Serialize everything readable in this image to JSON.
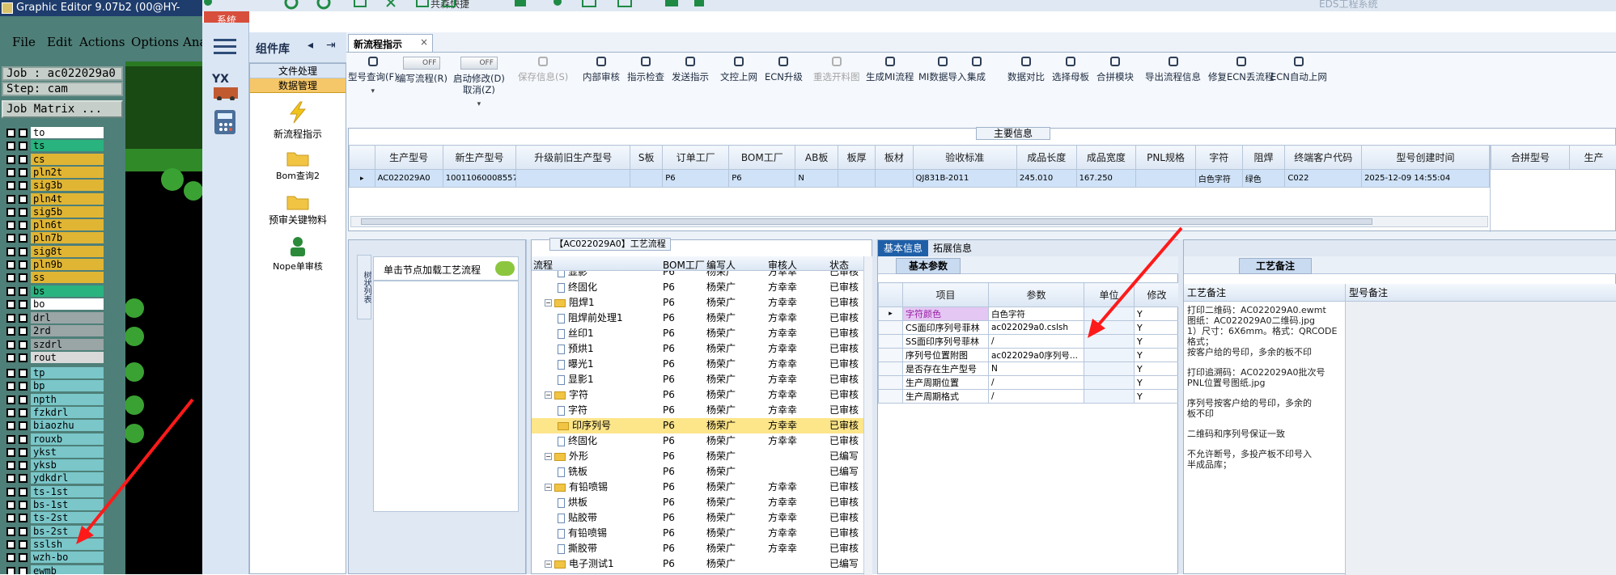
{
  "graphic_editor": {
    "title": "Graphic Editor 9.07b2 (00@HY-",
    "menu": [
      "File",
      "Edit",
      "Actions",
      "Options",
      "Ana"
    ],
    "job_label": "Job : ac022029a0",
    "step_label": "Step: cam",
    "matrix_button": "Job Matrix ...",
    "layers_group1": [
      {
        "name": "to",
        "color": "#ffffff"
      },
      {
        "name": "ts",
        "color": "#29b37f"
      },
      {
        "name": "cs",
        "color": "#e0b534"
      },
      {
        "name": "pln2t",
        "color": "#e0b534"
      },
      {
        "name": "sig3b",
        "color": "#e0b534"
      },
      {
        "name": "pln4t",
        "color": "#e0b534"
      },
      {
        "name": "sig5b",
        "color": "#e0b534"
      },
      {
        "name": "pln6t",
        "color": "#e0b534"
      },
      {
        "name": "pln7b",
        "color": "#e0b534"
      },
      {
        "name": "sig8t",
        "color": "#e0b534"
      },
      {
        "name": "pln9b",
        "color": "#e0b534"
      },
      {
        "name": "ss",
        "color": "#e0b534"
      },
      {
        "name": "bs",
        "color": "#29b37f"
      },
      {
        "name": "bo",
        "color": "#ffffff"
      }
    ],
    "layers_group2": [
      {
        "name": "drl",
        "color": "#9aa5a6"
      },
      {
        "name": "2rd",
        "color": "#9aa5a6"
      },
      {
        "name": "szdrl",
        "color": "#9aa5a6"
      },
      {
        "name": "rout",
        "color": "#d9d9d9"
      }
    ],
    "layers_group3": [
      {
        "name": "tp",
        "color": "#7ac6c9"
      },
      {
        "name": "bp",
        "color": "#7ac6c9"
      },
      {
        "name": "npth",
        "color": "#7ac6c9"
      },
      {
        "name": "fzkdrl",
        "color": "#7ac6c9"
      },
      {
        "name": "biaozhu",
        "color": "#7ac6c9"
      },
      {
        "name": "rouxb",
        "color": "#7ac6c9"
      },
      {
        "name": "ykst",
        "color": "#7ac6c9"
      },
      {
        "name": "yksb",
        "color": "#7ac6c9"
      },
      {
        "name": "ydkdrl",
        "color": "#7ac6c9"
      },
      {
        "name": "ts-1st",
        "color": "#7ac6c9"
      },
      {
        "name": "bs-1st",
        "color": "#7ac6c9"
      },
      {
        "name": "ts-2st",
        "color": "#7ac6c9"
      },
      {
        "name": "bs-2st",
        "color": "#7ac6c9"
      },
      {
        "name": "sslsh",
        "color": "#7ac6c9"
      },
      {
        "name": "wzh-bo",
        "color": "#7ac6c9"
      },
      {
        "name": "ewmb",
        "color": "#7ac6c9"
      }
    ]
  },
  "app": {
    "top_partial": "共森快捷",
    "window_title": "EDS工程系统",
    "system_tab": "系统",
    "component_lib": "组件库",
    "yx_label": "YX",
    "lib_sections": [
      "文件处理",
      "数据管理"
    ],
    "lib_items": [
      "新流程指示",
      "Bom查询2",
      "预审关键物料",
      "Nope单审核"
    ],
    "doc_tab": "新流程指示",
    "toolbar": [
      {
        "label": "型号查询(F)",
        "sub": "",
        "dis": false,
        "icon": "search-icon"
      },
      {
        "label": "编写流程(R)",
        "sub": "OFF",
        "dis": false,
        "icon": "toggle-icon"
      },
      {
        "label": "启动修改(D)",
        "sub": "OFF",
        "label2": "取消(Z)",
        "dis": false,
        "icon": "toggle-icon"
      },
      {
        "label": "保存信息(S)",
        "dis": true,
        "icon": "check-icon"
      },
      {
        "label": "内部审核",
        "dis": false,
        "icon": "print-icon"
      },
      {
        "label": "指示检查",
        "dis": false,
        "icon": "checklist-icon"
      },
      {
        "label": "发送指示",
        "dis": false,
        "icon": "upload-icon"
      },
      {
        "label": "文控上网",
        "dis": false,
        "icon": "cloud-upload-icon"
      },
      {
        "label": "ECN升级",
        "dis": false,
        "icon": "text-icon"
      },
      {
        "label": "重选开料图",
        "dis": true,
        "icon": "image-icon"
      },
      {
        "label": "生成MI流程",
        "dis": false,
        "icon": "gears-icon"
      },
      {
        "label": "MI数据导入",
        "dis": false,
        "icon": "import-icon"
      },
      {
        "label": "集成",
        "dis": false,
        "icon": "download-icon"
      },
      {
        "label": "数据对比",
        "dis": false,
        "icon": "compare-icon"
      },
      {
        "label": "选择母板",
        "dis": false,
        "icon": "shuffle-icon"
      },
      {
        "label": "合拼模块",
        "dis": false,
        "icon": "merge-icon"
      },
      {
        "label": "导出流程信息",
        "dis": false,
        "icon": "smile-icon"
      },
      {
        "label": "修复ECN丢流程",
        "dis": false,
        "icon": "wrench-icon"
      },
      {
        "label": "ECN自动上网",
        "dis": false,
        "icon": "star-icon"
      }
    ],
    "main_info_title": "主要信息",
    "main_headers": [
      "生产型号",
      "新生产型号",
      "升级前旧生产型号",
      "S板",
      "订单工厂",
      "BOM工厂",
      "AB板",
      "板厚",
      "板材",
      "验收标准",
      "成品长度",
      "成品宽度",
      "PNL规格",
      "字符",
      "阻焊",
      "终端客户代码",
      "型号创建时间"
    ],
    "main_row": [
      "AC022029A0",
      "10011060008557",
      "",
      "",
      "P6",
      "P6",
      "N",
      "",
      "",
      "QJ831B-2011",
      "245.010",
      "167.250",
      "",
      "白色字符",
      "绿色",
      "C022",
      "2025-12-09 14:55:04"
    ],
    "right_headers": [
      "合拼型号",
      "生产"
    ],
    "left_panel_title": "单击节点加载工艺流程",
    "left_panel_side": "树状列表",
    "process_title": "【AC022029A0】工艺流程",
    "process_headers": [
      "流程",
      "BOM工厂",
      "编写人",
      "审核人",
      "状态"
    ],
    "process_rows": [
      {
        "name": "显影",
        "level": 2,
        "type": "doc",
        "bom": "P6",
        "writer": "杨荣广",
        "checker": "方幸幸",
        "status": "已审核"
      },
      {
        "name": "终固化",
        "level": 2,
        "type": "doc",
        "bom": "P6",
        "writer": "杨荣广",
        "checker": "方幸幸",
        "status": "已审核"
      },
      {
        "name": "阻焊1",
        "level": 1,
        "type": "folder",
        "bom": "P6",
        "writer": "杨荣广",
        "checker": "方幸幸",
        "status": "已审核"
      },
      {
        "name": "阻焊前处理1",
        "level": 2,
        "type": "doc",
        "bom": "P6",
        "writer": "杨荣广",
        "checker": "方幸幸",
        "status": "已审核"
      },
      {
        "name": "丝印1",
        "level": 2,
        "type": "doc",
        "bom": "P6",
        "writer": "杨荣广",
        "checker": "方幸幸",
        "status": "已审核"
      },
      {
        "name": "预烘1",
        "level": 2,
        "type": "doc",
        "bom": "P6",
        "writer": "杨荣广",
        "checker": "方幸幸",
        "status": "已审核"
      },
      {
        "name": "曝光1",
        "level": 2,
        "type": "doc",
        "bom": "P6",
        "writer": "杨荣广",
        "checker": "方幸幸",
        "status": "已审核"
      },
      {
        "name": "显影1",
        "level": 2,
        "type": "doc",
        "bom": "P6",
        "writer": "杨荣广",
        "checker": "方幸幸",
        "status": "已审核"
      },
      {
        "name": "字符",
        "level": 1,
        "type": "folder",
        "bom": "P6",
        "writer": "杨荣广",
        "checker": "方幸幸",
        "status": "已审核"
      },
      {
        "name": "字符",
        "level": 2,
        "type": "doc",
        "bom": "P6",
        "writer": "杨荣广",
        "checker": "方幸幸",
        "status": "已审核"
      },
      {
        "name": "印序列号",
        "level": 2,
        "type": "folder",
        "bom": "P6",
        "writer": "杨荣广",
        "checker": "方幸幸",
        "status": "已审核",
        "selected": true
      },
      {
        "name": "终固化",
        "level": 2,
        "type": "doc",
        "bom": "P6",
        "writer": "杨荣广",
        "checker": "方幸幸",
        "status": "已审核"
      },
      {
        "name": "外形",
        "level": 1,
        "type": "folder",
        "bom": "P6",
        "writer": "杨荣广",
        "checker": "",
        "status": "已编写"
      },
      {
        "name": "铣板",
        "level": 2,
        "type": "doc",
        "bom": "P6",
        "writer": "杨荣广",
        "checker": "",
        "status": "已编写"
      },
      {
        "name": "有铅喷锡",
        "level": 1,
        "type": "folder",
        "bom": "P6",
        "writer": "杨荣广",
        "checker": "方幸幸",
        "status": "已审核"
      },
      {
        "name": "烘板",
        "level": 2,
        "type": "doc",
        "bom": "P6",
        "writer": "杨荣广",
        "checker": "方幸幸",
        "status": "已审核"
      },
      {
        "name": "贴胶带",
        "level": 2,
        "type": "doc",
        "bom": "P6",
        "writer": "杨荣广",
        "checker": "方幸幸",
        "status": "已审核"
      },
      {
        "name": "有铅喷锡",
        "level": 2,
        "type": "doc",
        "bom": "P6",
        "writer": "杨荣广",
        "checker": "方幸幸",
        "status": "已审核"
      },
      {
        "name": "撕胶带",
        "level": 2,
        "type": "doc",
        "bom": "P6",
        "writer": "杨荣广",
        "checker": "方幸幸",
        "status": "已审核"
      },
      {
        "name": "电子测试1",
        "level": 1,
        "type": "folder",
        "bom": "P6",
        "writer": "杨荣广",
        "checker": "",
        "status": "已编写"
      }
    ],
    "info_tabs": [
      "基本信息",
      "拓展信息"
    ],
    "basic_params_tab": "基本参数",
    "param_headers": [
      "项目",
      "参数",
      "单位",
      "修改"
    ],
    "param_rows": [
      {
        "item": "字符颜色",
        "value": "白色字符",
        "unit": "",
        "mod": "Y",
        "highlight": true
      },
      {
        "item": "CS面印序列号菲林",
        "value": "ac022029a0.cslsh",
        "unit": "",
        "mod": "Y"
      },
      {
        "item": "SS面印序列号菲林",
        "value": "/",
        "unit": "",
        "mod": "Y"
      },
      {
        "item": "序列号位置附图",
        "value": "ac022029a0序列号...",
        "unit": "",
        "mod": "Y"
      },
      {
        "item": "是否存在生产型号",
        "value": "N",
        "unit": "",
        "mod": "Y"
      },
      {
        "item": "生产周期位置",
        "value": "/",
        "unit": "",
        "mod": "Y"
      },
      {
        "item": "生产周期格式",
        "value": "/",
        "unit": "",
        "mod": "Y"
      }
    ],
    "notes_tab": "工艺备注",
    "notes_col1": "工艺备注",
    "notes_col2": "型号备注",
    "notes_text": [
      "打印二维码：AC022029A0.ewmt",
      "图纸：AC022029A0二维码.jpg",
      "1）尺寸：6X6mm。格式：QRCODE",
      "格式；",
      "按客户给的号印，多余的板不印",
      "",
      "打印追溯码：AC022029A0批次号",
      "PNL位置号图纸.jpg",
      "",
      "序列号按客户给的号印，多余的",
      "板不印",
      "",
      "二维码和序列号保证一致",
      "",
      "不允许断号，多投产板不印号入",
      "半成品库；"
    ]
  }
}
